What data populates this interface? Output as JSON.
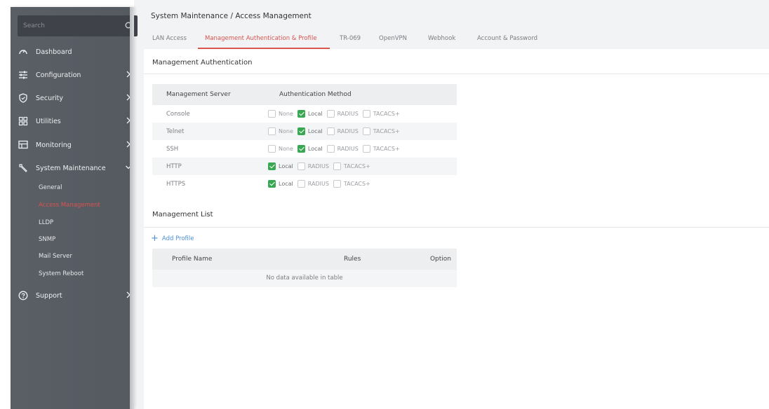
{
  "sidebar": {
    "search_placeholder": "Search",
    "items": [
      {
        "label": "Dashboard",
        "icon": "dashboard-icon",
        "arrow": false
      },
      {
        "label": "Configuration",
        "icon": "configuration-icon",
        "arrow": true
      },
      {
        "label": "Security",
        "icon": "shield-icon",
        "arrow": true
      },
      {
        "label": "Utilities",
        "icon": "utilities-icon",
        "arrow": true
      },
      {
        "label": "Monitoring",
        "icon": "monitor-icon",
        "arrow": true
      },
      {
        "label": "System Maintenance",
        "icon": "wrench-icon",
        "arrow": "down"
      },
      {
        "label": "Support",
        "icon": "help-icon",
        "arrow": true
      }
    ],
    "sub_items": [
      {
        "label": "General",
        "active": false
      },
      {
        "label": "Access Management",
        "active": true
      },
      {
        "label": "LLDP",
        "active": false
      },
      {
        "label": "SNMP",
        "active": false
      },
      {
        "label": "Mail Server",
        "active": false
      },
      {
        "label": "System Reboot",
        "active": false
      }
    ]
  },
  "header": {
    "breadcrumb": "System Maintenance / Access Management",
    "tabs": [
      {
        "label": "LAN Access",
        "active": false
      },
      {
        "label": "Management Authentication & Profile",
        "active": true
      },
      {
        "label": "TR-069",
        "active": false
      },
      {
        "label": "OpenVPN",
        "active": false
      },
      {
        "label": "Webhook",
        "active": false
      },
      {
        "label": "Account & Password",
        "active": false
      }
    ]
  },
  "auth": {
    "title": "Management Authentication",
    "col_server": "Management Server",
    "col_method": "Authentication Method",
    "rows": [
      {
        "server": "Console",
        "options": [
          {
            "label": "None",
            "checked": false
          },
          {
            "label": "Local",
            "checked": true
          },
          {
            "label": "RADIUS",
            "checked": false
          },
          {
            "label": "TACACS+",
            "checked": false
          }
        ]
      },
      {
        "server": "Telnet",
        "options": [
          {
            "label": "None",
            "checked": false
          },
          {
            "label": "Local",
            "checked": true
          },
          {
            "label": "RADIUS",
            "checked": false
          },
          {
            "label": "TACACS+",
            "checked": false
          }
        ]
      },
      {
        "server": "SSH",
        "options": [
          {
            "label": "None",
            "checked": false
          },
          {
            "label": "Local",
            "checked": true
          },
          {
            "label": "RADIUS",
            "checked": false
          },
          {
            "label": "TACACS+",
            "checked": false
          }
        ]
      },
      {
        "server": "HTTP",
        "options": [
          {
            "label": "Local",
            "checked": true
          },
          {
            "label": "RADIUS",
            "checked": false
          },
          {
            "label": "TACACS+",
            "checked": false
          }
        ]
      },
      {
        "server": "HTTPS",
        "options": [
          {
            "label": "Local",
            "checked": true
          },
          {
            "label": "RADIUS",
            "checked": false
          },
          {
            "label": "TACACS+",
            "checked": false
          }
        ]
      }
    ]
  },
  "mgmt_list": {
    "title": "Management List",
    "add_label": "Add Profile",
    "col_profile": "Profile Name",
    "col_rules": "Rules",
    "col_option": "Option",
    "empty_text": "No data available in table"
  },
  "colors": {
    "accent_red": "#d9534f",
    "check_green": "#3aa853",
    "link_blue": "#4a90d9",
    "sidebar_bg": "#5a5f66"
  }
}
